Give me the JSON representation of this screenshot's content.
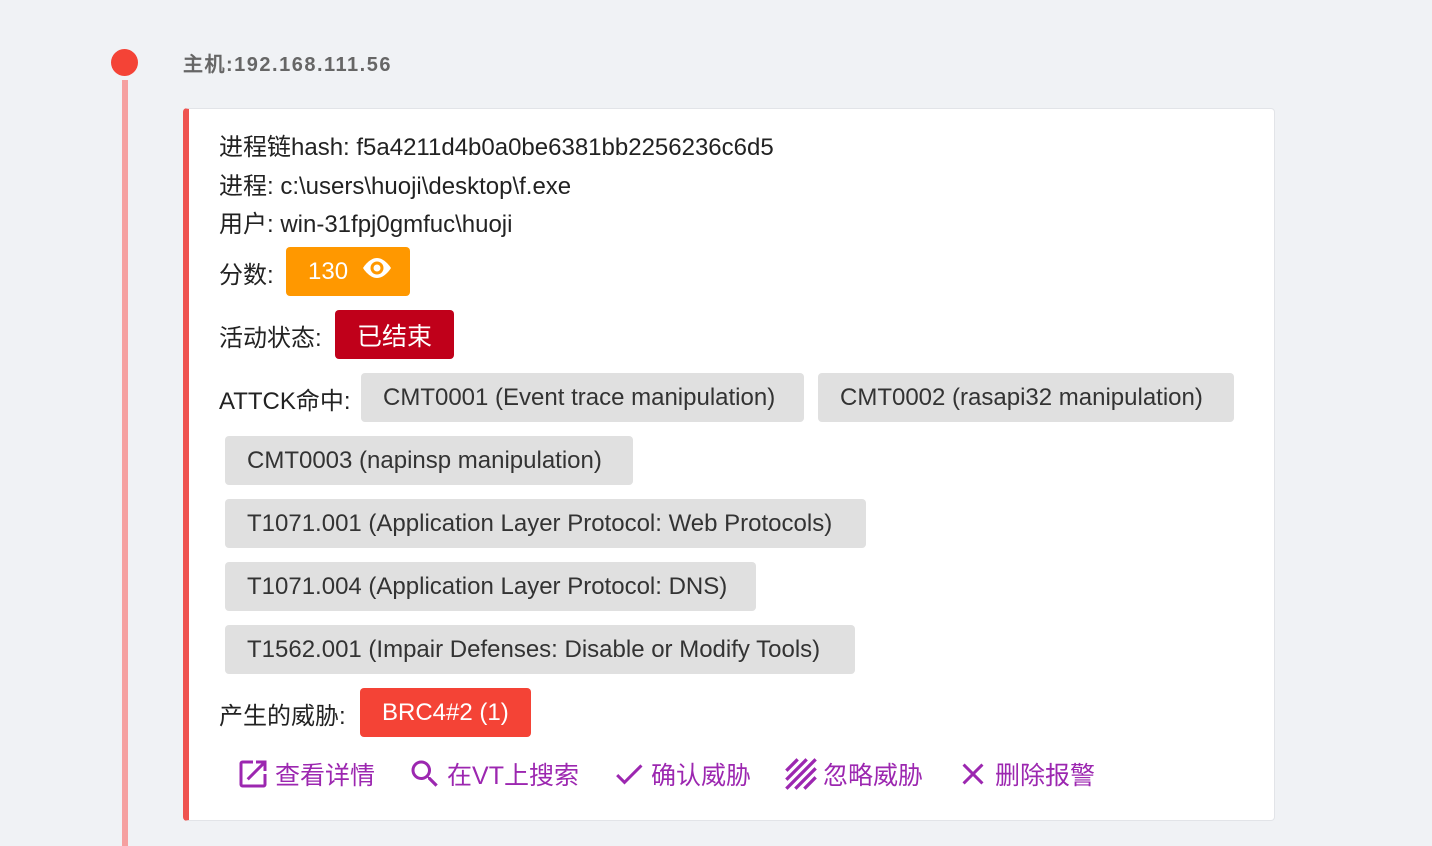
{
  "host": {
    "title": "主机:192.168.111.56"
  },
  "details": {
    "hash_line": "进程链hash: f5a4211d4b0a0be6381bb2256236c6d5",
    "process_line": "进程: c:\\users\\huoji\\desktop\\f.exe",
    "user_line": "用户: win-31fpj0gmfuc\\huoji"
  },
  "score": {
    "label": "分数:",
    "value": "130",
    "icon": "eye-icon"
  },
  "status": {
    "label": "活动状态:",
    "value": "已结束"
  },
  "attck": {
    "label": "ATTCK命中:",
    "items": [
      "CMT0001 (Event trace manipulation)",
      "CMT0002 (rasapi32 manipulation)",
      "CMT0003 (napinsp manipulation)",
      "T1071.001 (Application Layer Protocol: Web Protocols)",
      "T1071.004 (Application Layer Protocol: DNS)",
      "T1562.001 (Impair Defenses: Disable or Modify Tools)"
    ]
  },
  "threat": {
    "label": "产生的威胁:",
    "value": "BRC4#2 (1)"
  },
  "actions": [
    {
      "label": "查看详情",
      "icon": "open-in-new-icon"
    },
    {
      "label": "在VT上搜索",
      "icon": "search-icon"
    },
    {
      "label": "确认威胁",
      "icon": "check-icon"
    },
    {
      "label": "忽略威胁",
      "icon": "ignore-stripes-icon"
    },
    {
      "label": "删除报警",
      "icon": "close-icon"
    }
  ],
  "colors": {
    "timeline_dot": "#f44336",
    "timeline_line": "#f5a0a0",
    "card_accent": "#ef5350",
    "score": "#ff9800",
    "status_ended": "#c0001a",
    "threat": "#f44336",
    "action": "#9c27b0",
    "chip": "#e0e0e0"
  }
}
